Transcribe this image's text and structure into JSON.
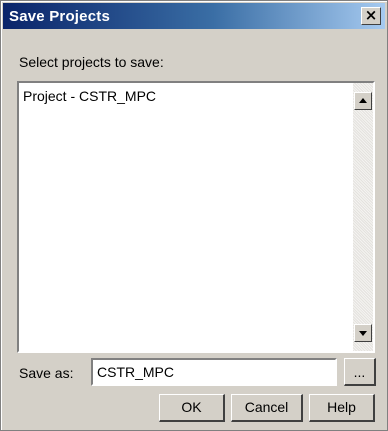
{
  "dialog": {
    "title": "Save Projects",
    "close_glyph": "×",
    "close_icon": "close-icon",
    "prompt": "Select projects to save:",
    "projects": [
      {
        "label": "Project - CSTR_MPC"
      }
    ],
    "save_as": {
      "label": "Save as:",
      "value": "CSTR_MPC",
      "browse_label": "..."
    },
    "buttons": {
      "ok": "OK",
      "cancel": "Cancel",
      "help": "Help"
    }
  },
  "colors": {
    "titlebar_start": "#0a246a",
    "titlebar_end": "#a6caf0",
    "face": "#d4d0c8"
  }
}
